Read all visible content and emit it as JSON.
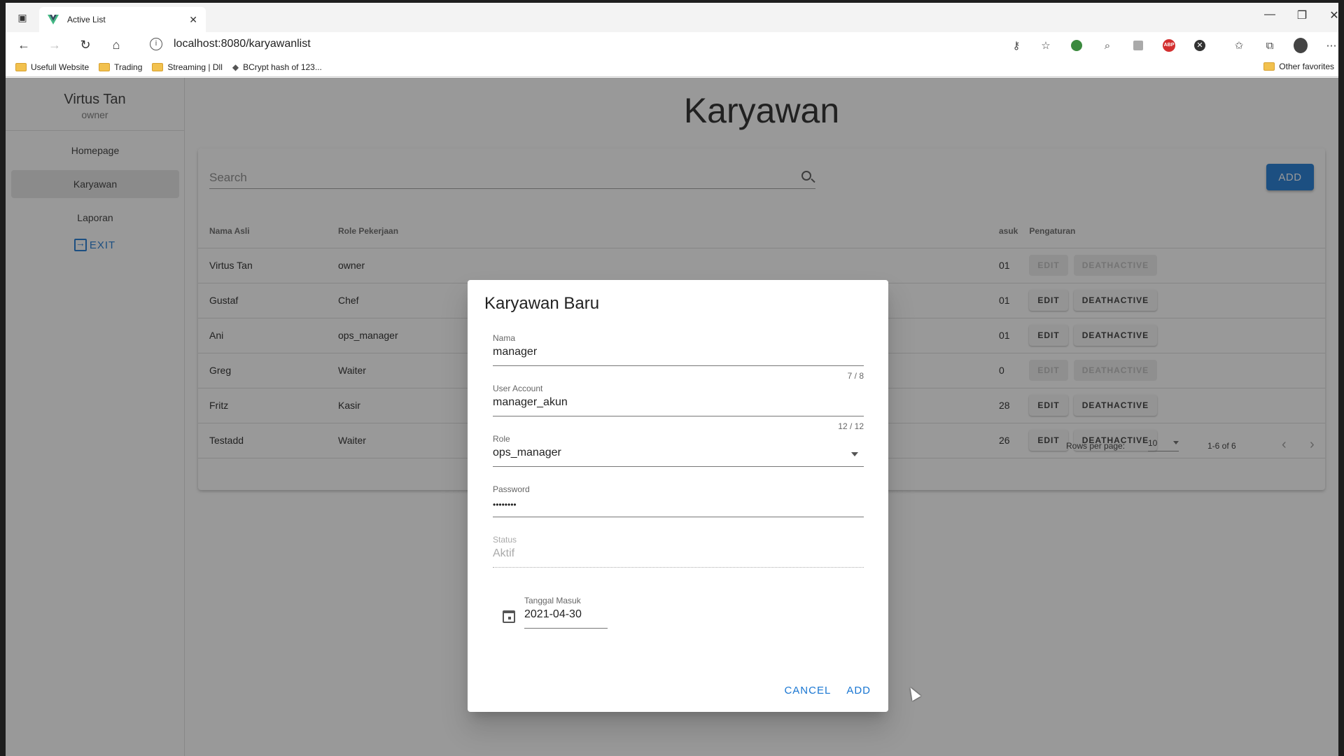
{
  "browser": {
    "tab_title": "Active List",
    "url": "localhost:8080/karyawanlist",
    "bookmarks": [
      "Usefull Website",
      "Trading",
      "Streaming | Dll",
      "BCrypt hash of 123..."
    ],
    "other_favorites": "Other favorites"
  },
  "sidebar": {
    "user_name": "Virtus Tan",
    "user_role": "owner",
    "items": [
      {
        "label": "Homepage",
        "active": false
      },
      {
        "label": "Karyawan",
        "active": true
      },
      {
        "label": "Laporan",
        "active": false
      }
    ],
    "exit_label": "EXIT"
  },
  "main": {
    "title": "Karyawan",
    "search_label": "Search",
    "add_label": "ADD",
    "table": {
      "headers": [
        "Nama Asli",
        "Role Pekerjaan",
        "Tanggal Masuk",
        "Pengaturan"
      ],
      "header_visible": [
        "Nama Asli",
        "Role Pekerjaan",
        "asuk",
        "Pengaturan"
      ],
      "rows": [
        {
          "name": "Virtus Tan",
          "role": "owner",
          "date_frag": "01",
          "enabled": false
        },
        {
          "name": "Gustaf",
          "role": "Chef",
          "date_frag": "01",
          "enabled": true
        },
        {
          "name": "Ani",
          "role": "ops_manager",
          "date_frag": "01",
          "enabled": true
        },
        {
          "name": "Greg",
          "role": "Waiter",
          "date_frag": "0",
          "enabled": false
        },
        {
          "name": "Fritz",
          "role": "Kasir",
          "date_frag": "28",
          "enabled": true
        },
        {
          "name": "Testadd",
          "role": "Waiter",
          "date_frag": "26",
          "enabled": true
        }
      ],
      "edit_label": "EDIT",
      "deactive_label": "DEATHACTIVE"
    },
    "pager": {
      "rows_per_page_label": "Rows per page:",
      "rows_per_page": "10",
      "range": "1-6 of 6"
    }
  },
  "dialog": {
    "title": "Karyawan Baru",
    "nama": {
      "label": "Nama",
      "value": "manager",
      "counter": "7 / 8"
    },
    "user_account": {
      "label": "User Account",
      "value": "manager_akun",
      "counter": "12 / 12"
    },
    "role": {
      "label": "Role",
      "value": "ops_manager"
    },
    "password": {
      "label": "Password",
      "value": "••••••••"
    },
    "status": {
      "label": "Status",
      "value": "Aktif"
    },
    "tanggal_masuk": {
      "label": "Tanggal Masuk",
      "value": "2021-04-30"
    },
    "cancel_label": "CANCEL",
    "add_label": "ADD"
  },
  "colors": {
    "primary": "#1976d2",
    "overlay": "rgba(33,33,33,0.46)"
  }
}
